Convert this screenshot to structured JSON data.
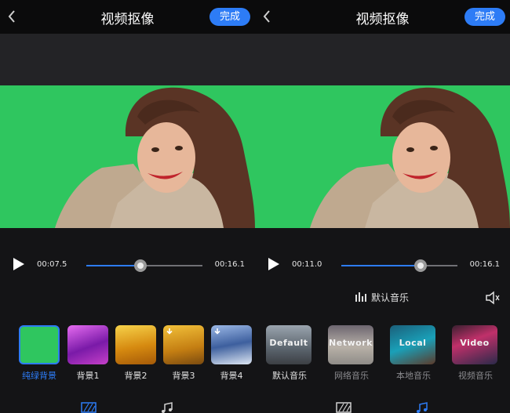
{
  "left": {
    "title": "视频抠像",
    "done_label": "完成",
    "time_current": "00:07.5",
    "time_total": "00:16.1",
    "progress": 0.465,
    "backgrounds": [
      {
        "label": "纯绿背景",
        "state": "selected"
      },
      {
        "label": "背景1",
        "state": "normal"
      },
      {
        "label": "背景2",
        "state": "normal"
      },
      {
        "label": "背景3",
        "state": "download"
      },
      {
        "label": "背景4",
        "state": "download"
      }
    ]
  },
  "right": {
    "title": "视频抠像",
    "done_label": "完成",
    "time_current": "00:11.0",
    "time_total": "00:16.1",
    "progress": 0.685,
    "music_label": "默认音乐",
    "music_sources": [
      {
        "overlay": "Default",
        "label": "默认音乐",
        "state": "normal"
      },
      {
        "overlay": "Network",
        "label": "网络音乐",
        "state": "dim"
      },
      {
        "overlay": "Local",
        "label": "本地音乐",
        "state": "dim"
      },
      {
        "overlay": "Video",
        "label": "视频音乐",
        "state": "dim"
      }
    ]
  },
  "colors": {
    "accent": "#2d7cf6",
    "chroma_green": "#2fc65f",
    "background": "#141416"
  },
  "icons": [
    "back-arrow-icon",
    "play-icon",
    "equalizer-bars-icon",
    "speaker-icon",
    "download-icon",
    "background-tab-icon",
    "music-tab-icon"
  ]
}
